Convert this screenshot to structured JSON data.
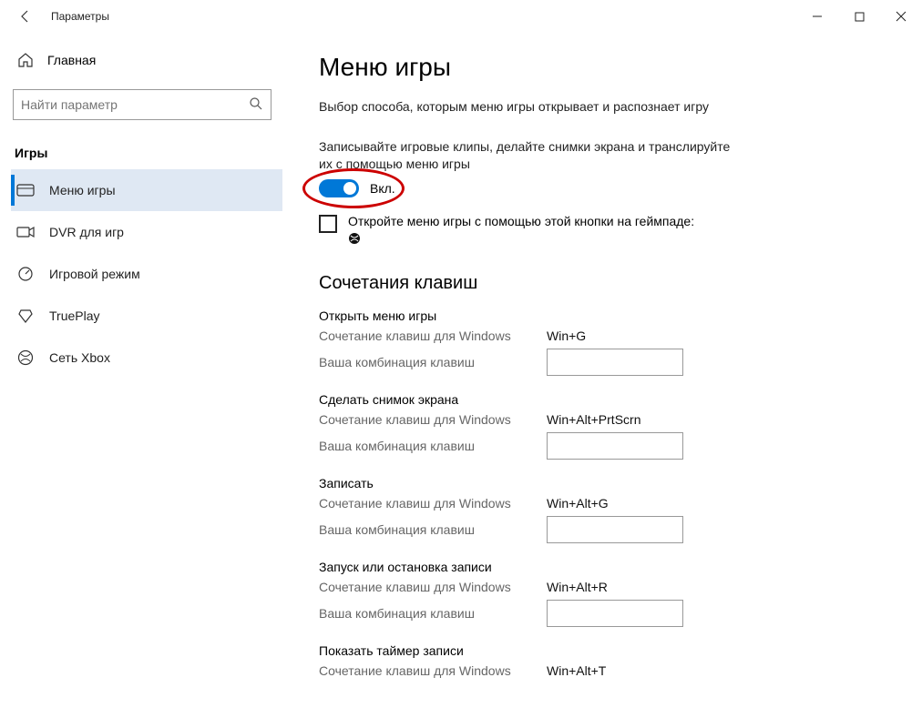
{
  "window": {
    "title": "Параметры"
  },
  "sidebar": {
    "home": "Главная",
    "search_placeholder": "Найти параметр",
    "category": "Игры",
    "items": [
      {
        "label": "Меню игры"
      },
      {
        "label": "DVR для игр"
      },
      {
        "label": "Игровой режим"
      },
      {
        "label": "TruePlay"
      },
      {
        "label": "Сеть Xbox"
      }
    ]
  },
  "page": {
    "title": "Меню игры",
    "desc1": "Выбор способа, которым меню игры открывает и распознает игру",
    "desc2": "Записывайте игровые клипы, делайте снимки экрана и транслируйте их с помощью меню игры",
    "toggle_state": "Вкл.",
    "checkbox_label": "Откройте меню игры с помощью этой кнопки на геймпаде:",
    "shortcuts_heading": "Сочетания клавиш",
    "row_win_label": "Сочетание клавиш для Windows",
    "row_user_label": "Ваша комбинация клавиш",
    "shortcuts": [
      {
        "title": "Открыть меню игры",
        "win": "Win+G"
      },
      {
        "title": "Сделать снимок экрана",
        "win": "Win+Alt+PrtScrn"
      },
      {
        "title": "Записать",
        "win": "Win+Alt+G"
      },
      {
        "title": "Запуск или остановка записи",
        "win": "Win+Alt+R"
      },
      {
        "title": "Показать таймер записи",
        "win": "Win+Alt+T"
      }
    ]
  }
}
